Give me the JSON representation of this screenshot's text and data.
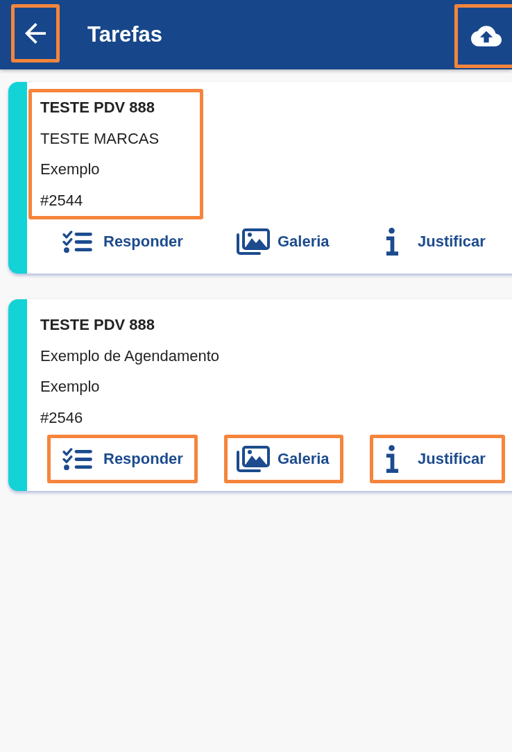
{
  "app_bar": {
    "title": "Tarefas",
    "back_button": {
      "highlighted": true
    },
    "upload_button": {
      "highlighted": true
    }
  },
  "tasks": [
    {
      "title": "TESTE PDV 888",
      "subtitle": "TESTE MARCAS",
      "category": "Exemplo",
      "number": "#2544",
      "details_highlighted": true,
      "actions": [
        {
          "kind": "respond",
          "label": "Responder",
          "highlighted": false
        },
        {
          "kind": "gallery",
          "label": "Galeria",
          "highlighted": false
        },
        {
          "kind": "justify",
          "label": "Justificar",
          "highlighted": false
        }
      ]
    },
    {
      "title": "TESTE PDV 888",
      "subtitle": "Exemplo de Agendamento",
      "category": "Exemplo",
      "number": "#2546",
      "details_highlighted": false,
      "actions": [
        {
          "kind": "respond",
          "label": "Responder",
          "highlighted": true
        },
        {
          "kind": "gallery",
          "label": "Galeria",
          "highlighted": true
        },
        {
          "kind": "justify",
          "label": "Justificar",
          "highlighted": true
        }
      ]
    }
  ]
}
